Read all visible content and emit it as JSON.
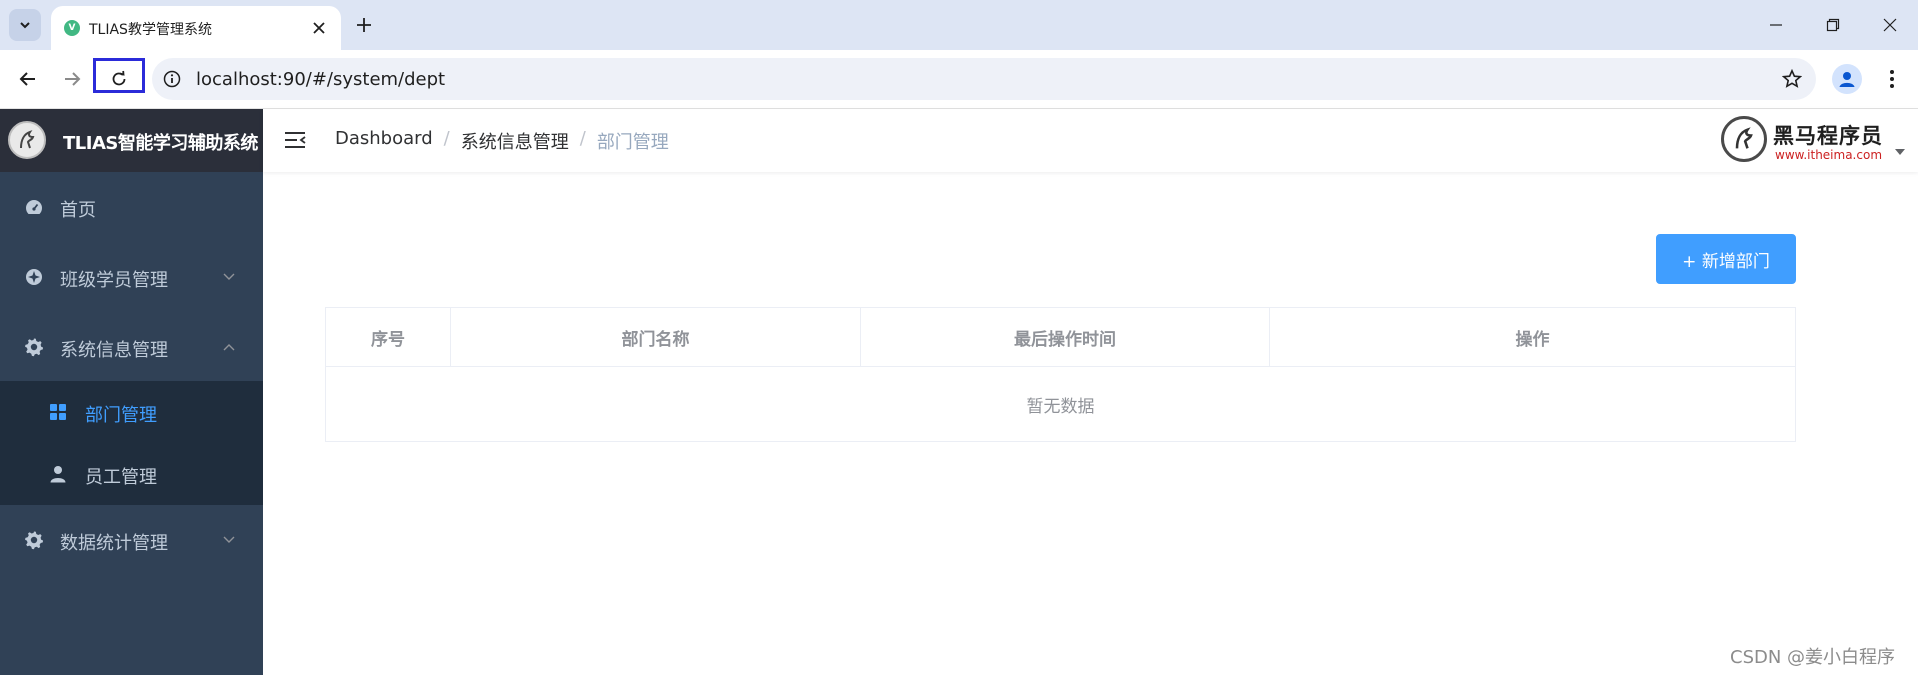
{
  "browser": {
    "tab_title": "TLIAS教学管理系统",
    "favicon_letter": "V",
    "url": "localhost:90/#/system/dept"
  },
  "app": {
    "brand_title": "TLIAS智能学习辅助系统"
  },
  "sidebar": {
    "items": [
      {
        "label": "首页",
        "icon": "dashboard-icon"
      },
      {
        "label": "班级学员管理",
        "icon": "compass-icon",
        "expanded": false
      },
      {
        "label": "系统信息管理",
        "icon": "gear-icon",
        "expanded": true,
        "children": [
          {
            "label": "部门管理",
            "icon": "grid-icon",
            "active": true
          },
          {
            "label": "员工管理",
            "icon": "user-icon",
            "active": false
          }
        ]
      },
      {
        "label": "数据统计管理",
        "icon": "gear-icon",
        "expanded": false
      }
    ]
  },
  "navbar": {
    "breadcrumb": [
      "Dashboard",
      "系统信息管理",
      "部门管理"
    ],
    "corp_name": "黑马程序员",
    "corp_url": "www.itheima.com"
  },
  "main": {
    "add_button_label": "+ 新增部门",
    "table": {
      "columns": [
        "序号",
        "部门名称",
        "最后操作时间",
        "操作"
      ],
      "empty_text": "暂无数据"
    }
  },
  "watermark": "CSDN @姜小白程序",
  "colors": {
    "sidebar_bg": "#304156",
    "submenu_bg": "#1f2d3d",
    "active_text": "#409eff",
    "primary_button": "#409eff"
  }
}
